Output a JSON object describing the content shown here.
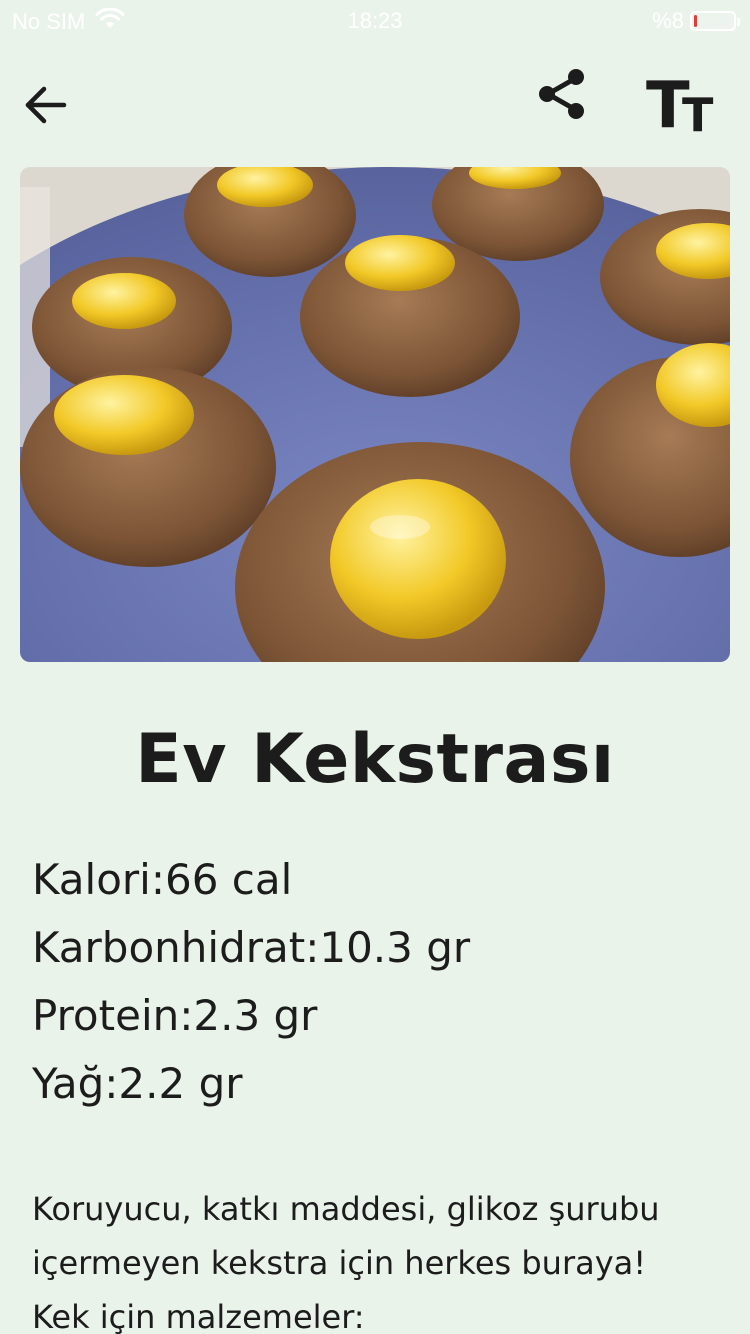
{
  "status_bar": {
    "carrier": "No SIM",
    "time": "18:23",
    "battery_text": "%8",
    "battery_level_percent": 8
  },
  "toolbar": {
    "back_icon": "arrow-left-icon",
    "share_icon": "share-icon",
    "text_size_icon": "text-size-icon",
    "text_size_glyph_large": "T",
    "text_size_glyph_small": "T"
  },
  "recipe": {
    "title": "Ev Kekstrası",
    "nutrition": [
      "Kalori:66 cal",
      "Karbonhidrat:10.3 gr",
      "Protein:2.3 gr",
      "Yağ:2.2 gr"
    ],
    "description": [
      "Koruyucu, katkı maddesi, glikoz şurubu",
      "içermeyen kekstra için herkes buraya!",
      "Kek için malzemeler:"
    ]
  },
  "colors": {
    "background": "#eaf3ea",
    "text": "#1c1c1c",
    "battery_low": "#e23b3b"
  }
}
